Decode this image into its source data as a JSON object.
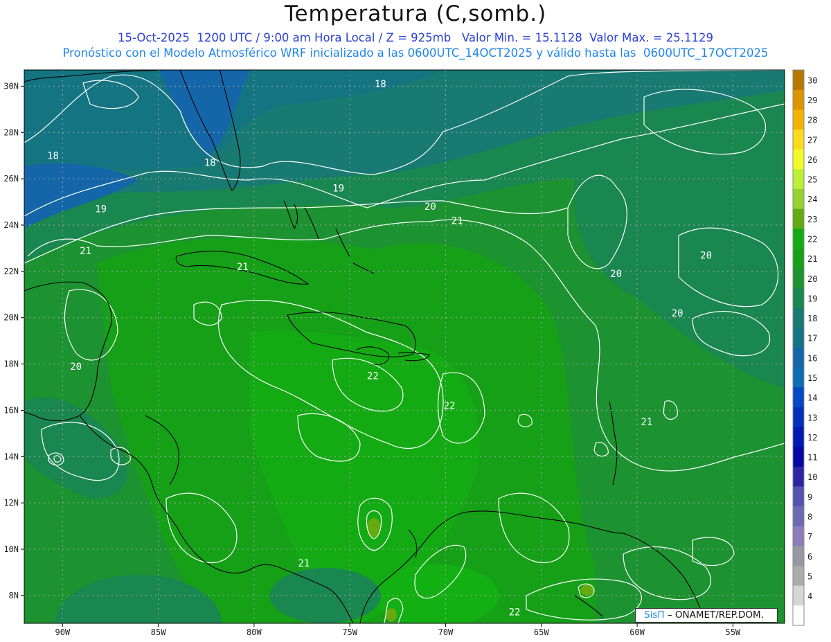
{
  "header": {
    "title": "Temperatura (C,somb.)",
    "subtitle_line1": "15-Oct-2025  1200 UTC / 9:00 am Hora Local / Z = 925mb   Valor Min. = 15.1128  Valor Max. = 25.1129",
    "subtitle_line2": "Pronóstico con el Modelo Atmosférico WRF inicializado a las 0600UTC_14OCT2025 y válido hasta las  0600UTC_17OCT2025"
  },
  "chart_data": {
    "type": "heatmap",
    "title": "Temperatura (C,somb.)",
    "variable": "Temperatura",
    "units": "C",
    "level": "Z = 925mb",
    "date": "15-Oct-2025",
    "time": "1200 UTC / 9:00 am Hora Local",
    "value_min": 15.1128,
    "value_max": 25.1129,
    "lon_range": [
      -92.0,
      -52.3
    ],
    "lat_range": [
      6.8,
      30.7
    ],
    "x_ticks": [
      {
        "lon": -90,
        "label": "90W"
      },
      {
        "lon": -85,
        "label": "85W"
      },
      {
        "lon": -80,
        "label": "80W"
      },
      {
        "lon": -75,
        "label": "75W"
      },
      {
        "lon": -70,
        "label": "70W"
      },
      {
        "lon": -65,
        "label": "65W"
      },
      {
        "lon": -60,
        "label": "60W"
      },
      {
        "lon": -55,
        "label": "55W"
      }
    ],
    "y_ticks": [
      {
        "lat": 30,
        "label": "30N"
      },
      {
        "lat": 28,
        "label": "28N"
      },
      {
        "lat": 26,
        "label": "26N"
      },
      {
        "lat": 24,
        "label": "24N"
      },
      {
        "lat": 22,
        "label": "22N"
      },
      {
        "lat": 20,
        "label": "20N"
      },
      {
        "lat": 18,
        "label": "18N"
      },
      {
        "lat": 16,
        "label": "16N"
      },
      {
        "lat": 14,
        "label": "14N"
      },
      {
        "lat": 12,
        "label": "12N"
      },
      {
        "lat": 10,
        "label": "10N"
      },
      {
        "lat": 8,
        "label": "8N"
      }
    ],
    "grid": true,
    "colorbar": {
      "placement": "right",
      "levels": [
        {
          "label": "30",
          "color": "#b87800"
        },
        {
          "label": "29",
          "color": "#dc9400"
        },
        {
          "label": "28",
          "color": "#f0b400"
        },
        {
          "label": "27",
          "color": "#fadc1c"
        },
        {
          "label": "26",
          "color": "#f4fa28"
        },
        {
          "label": "25",
          "color": "#bcf036"
        },
        {
          "label": "24",
          "color": "#96d230"
        },
        {
          "label": "23",
          "color": "#64aa10"
        },
        {
          "label": "22",
          "color": "#14aa14"
        },
        {
          "label": "21",
          "color": "#16a018"
        },
        {
          "label": "20",
          "color": "#1c9230"
        },
        {
          "label": "19",
          "color": "#1a8650"
        },
        {
          "label": "18",
          "color": "#187a72"
        },
        {
          "label": "17",
          "color": "#147482"
        },
        {
          "label": "16",
          "color": "#1466a8"
        },
        {
          "label": "15",
          "color": "#0c6cb4"
        },
        {
          "label": "14",
          "color": "#0448c4"
        },
        {
          "label": "13",
          "color": "#0430b8"
        },
        {
          "label": "12",
          "color": "#0018b4"
        },
        {
          "label": "11",
          "color": "#0408a4"
        },
        {
          "label": "10",
          "color": "#2e24a4"
        },
        {
          "label": "9",
          "color": "#5454b0"
        },
        {
          "label": "8",
          "color": "#6a6ab2"
        },
        {
          "label": "7",
          "color": "#8c7cbc"
        },
        {
          "label": "6",
          "color": "#9898a4"
        },
        {
          "label": "5",
          "color": "#acacac"
        },
        {
          "label": "4",
          "color": "#d6d6d6"
        },
        {
          "label": "",
          "color": "#ffffff"
        }
      ]
    },
    "contour_labels": [
      {
        "value": "18",
        "lon": -73.4,
        "lat": 30.1
      },
      {
        "value": "18",
        "lon": -90.5,
        "lat": 27.0
      },
      {
        "value": "18",
        "lon": -82.3,
        "lat": 26.7
      },
      {
        "value": "19",
        "lon": -75.6,
        "lat": 25.6
      },
      {
        "value": "19",
        "lon": -88.0,
        "lat": 24.7
      },
      {
        "value": "20",
        "lon": -70.8,
        "lat": 24.8
      },
      {
        "value": "21",
        "lon": -69.4,
        "lat": 24.2
      },
      {
        "value": "20",
        "lon": -56.4,
        "lat": 22.7
      },
      {
        "value": "21",
        "lon": -88.8,
        "lat": 22.9
      },
      {
        "value": "21",
        "lon": -80.6,
        "lat": 22.2
      },
      {
        "value": "20",
        "lon": -61.1,
        "lat": 21.9
      },
      {
        "value": "20",
        "lon": -57.9,
        "lat": 20.2
      },
      {
        "value": "20",
        "lon": -89.3,
        "lat": 17.9
      },
      {
        "value": "22",
        "lon": -73.8,
        "lat": 17.5
      },
      {
        "value": "22",
        "lon": -69.8,
        "lat": 16.2
      },
      {
        "value": "21",
        "lon": -59.5,
        "lat": 15.5
      },
      {
        "value": "21",
        "lon": -77.4,
        "lat": 9.4
      },
      {
        "value": "22",
        "lon": -66.4,
        "lat": 7.3
      }
    ]
  },
  "footer": {
    "brand": "SisΠ",
    "credit": "– ONAMET/REP.DOM."
  }
}
